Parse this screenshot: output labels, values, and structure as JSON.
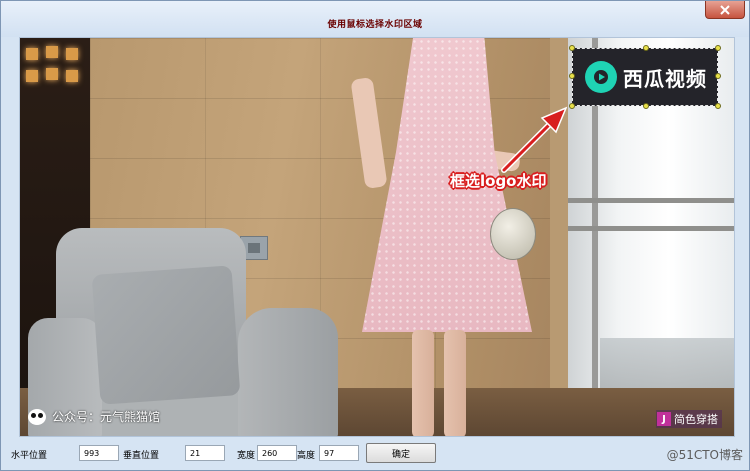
{
  "window": {
    "title": "使用鼠标选择水印区域",
    "close_icon": "close-x-icon"
  },
  "video": {
    "logo_text": "西瓜视频",
    "logo_icon": "play-icon",
    "annotation": "框选logo水印",
    "caption_left": "公众号：元气熊猫馆",
    "caption_left_icon": "panda-icon",
    "caption_right_badge": "J",
    "caption_right": "简色穿搭"
  },
  "controls": {
    "x_label": "水平位置",
    "x_value": "993",
    "y_label": "垂直位置",
    "y_value": "21",
    "width_label": "宽度",
    "width_value": "260",
    "height_label": "高度",
    "height_value": "97",
    "ok_label": "确定"
  },
  "footer": {
    "watermark": "@51CTO博客"
  },
  "colors": {
    "annotation_stroke": "#d81e1e",
    "logo_accent": "#1fd3b4",
    "title_text": "#6a0000"
  }
}
